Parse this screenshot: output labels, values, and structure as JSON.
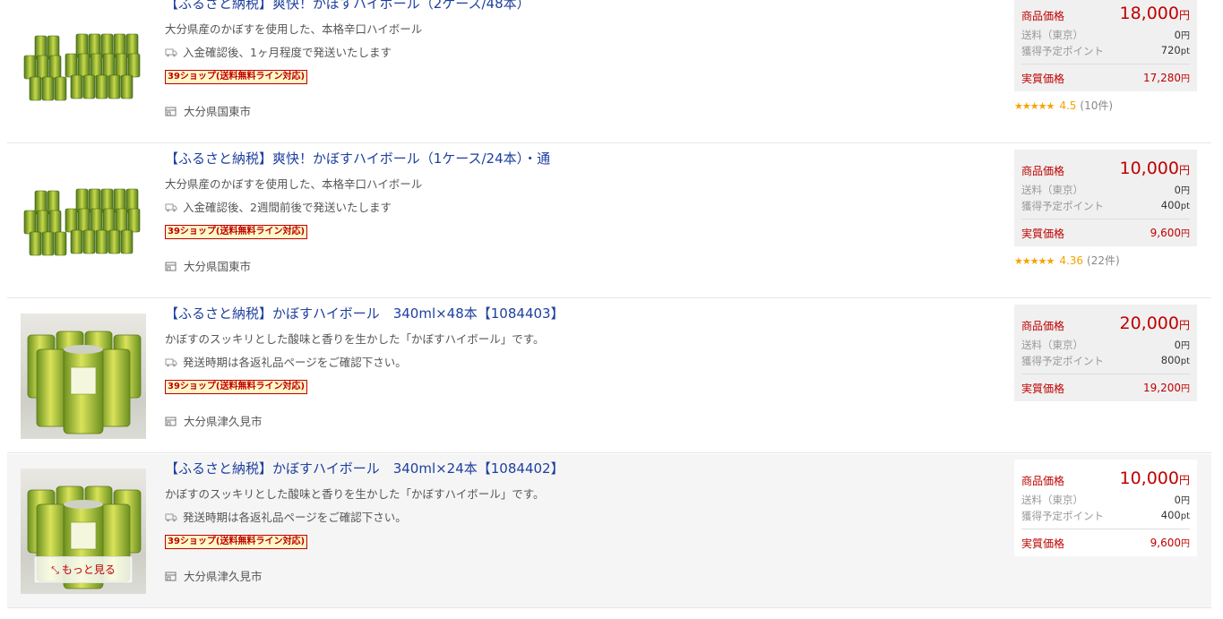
{
  "colors": {
    "accent": "#bf0000",
    "link": "#1d3f9e",
    "star": "#f5a300"
  },
  "products": [
    {
      "title": "【ふるさと納税】爽快！かぼすハイボール（2ケース/48本）",
      "description": "大分県産のかぼすを使用した、本格辛口ハイボール",
      "shipping": "入金確認後、1ヶ月程度で発送いたします",
      "badge": "39ショップ(送料無料ライン対応)",
      "location": "大分県国東市",
      "price_label": "商品価格",
      "price": "18,000",
      "yen": "円",
      "shipping_fee_label": "送料（東京）",
      "shipping_fee": "0",
      "points_label": "獲得予定ポイント",
      "points": "720",
      "pt": "pt",
      "real_price_label": "実質価格",
      "real_price": "17,280",
      "rating_stars": "★★★★★",
      "rating": "4.5",
      "review_count": "(10件)"
    },
    {
      "title": "【ふるさと納税】爽快！かぼすハイボール（1ケース/24本）・通",
      "description": "大分県産のかぼすを使用した、本格辛口ハイボール",
      "shipping": "入金確認後、2週間前後で発送いたします",
      "badge": "39ショップ(送料無料ライン対応)",
      "location": "大分県国東市",
      "price_label": "商品価格",
      "price": "10,000",
      "yen": "円",
      "shipping_fee_label": "送料（東京）",
      "shipping_fee": "0",
      "points_label": "獲得予定ポイント",
      "points": "400",
      "pt": "pt",
      "real_price_label": "実質価格",
      "real_price": "9,600",
      "rating_stars": "★★★★★",
      "rating": "4.36",
      "review_count": "(22件)"
    },
    {
      "title": "【ふるさと納税】かぼすハイボール　340ml×48本【1084403】",
      "description": "かぼすのスッキリとした酸味と香りを生かした「かぼすハイボール」です。",
      "shipping": "発送時期は各返礼品ページをご確認下さい。",
      "badge": "39ショップ(送料無料ライン対応)",
      "location": "大分県津久見市",
      "price_label": "商品価格",
      "price": "20,000",
      "yen": "円",
      "shipping_fee_label": "送料（東京）",
      "shipping_fee": "0",
      "points_label": "獲得予定ポイント",
      "points": "800",
      "pt": "pt",
      "real_price_label": "実質価格",
      "real_price": "19,200"
    },
    {
      "title": "【ふるさと納税】かぼすハイボール　340ml×24本【1084402】",
      "description": "かぼすのスッキリとした酸味と香りを生かした「かぼすハイボール」です。",
      "shipping": "発送時期は各返礼品ページをご確認下さい。",
      "badge": "39ショップ(送料無料ライン対応)",
      "location": "大分県津久見市",
      "price_label": "商品価格",
      "price": "10,000",
      "yen": "円",
      "shipping_fee_label": "送料（東京）",
      "shipping_fee": "0",
      "points_label": "獲得予定ポイント",
      "points": "400",
      "pt": "pt",
      "real_price_label": "実質価格",
      "real_price": "9,600",
      "more_label": "もっと見る"
    }
  ]
}
